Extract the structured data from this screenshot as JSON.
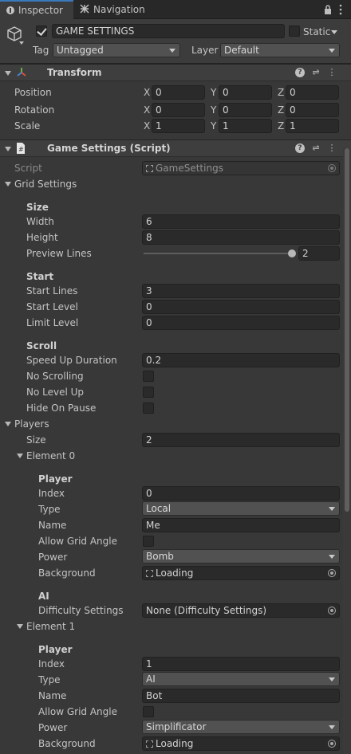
{
  "tabs": [
    {
      "label": "Inspector",
      "icon": "info-icon"
    },
    {
      "label": "Navigation",
      "icon": "navigation-icon"
    }
  ],
  "object": {
    "active": true,
    "name": "GAME SETTINGS",
    "static_label": "Static",
    "static": false,
    "tag_label": "Tag",
    "tag_value": "Untagged",
    "layer_label": "Layer",
    "layer_value": "Default"
  },
  "transform": {
    "title": "Transform",
    "rows": [
      {
        "label": "Position",
        "x": "0",
        "y": "0",
        "z": "0"
      },
      {
        "label": "Rotation",
        "x": "0",
        "y": "0",
        "z": "0"
      },
      {
        "label": "Scale",
        "x": "1",
        "y": "1",
        "z": "1"
      }
    ],
    "axis_x": "X",
    "axis_y": "Y",
    "axis_z": "Z"
  },
  "script_component": {
    "title": "Game Settings (Script)",
    "script_label": "Script",
    "script_value": "GameSettings"
  },
  "grid_settings": {
    "label": "Grid Settings",
    "size_header": "Size",
    "width_label": "Width",
    "width": "6",
    "height_label": "Height",
    "height": "8",
    "preview_label": "Preview Lines",
    "preview_value": "2",
    "preview_fraction": 1.0,
    "start_header": "Start",
    "start_lines_label": "Start Lines",
    "start_lines": "3",
    "start_level_label": "Start Level",
    "start_level": "0",
    "limit_level_label": "Limit Level",
    "limit_level": "0",
    "scroll_header": "Scroll",
    "speed_label": "Speed Up Duration",
    "speed": "0.2",
    "no_scrolling_label": "No Scrolling",
    "no_scrolling": false,
    "no_level_up_label": "No Level Up",
    "no_level_up": false,
    "hide_pause_label": "Hide On Pause",
    "hide_pause": false
  },
  "players": {
    "label": "Players",
    "size_label": "Size",
    "size": "2",
    "elements": [
      {
        "label": "Element 0",
        "player_header": "Player",
        "index_label": "Index",
        "index": "0",
        "type_label": "Type",
        "type": "Local",
        "name_label": "Name",
        "name": "Me",
        "grid_angle_label": "Allow Grid Angle",
        "grid_angle": false,
        "power_label": "Power",
        "power": "Bomb",
        "background_label": "Background",
        "background": "Loading",
        "ai_header": "AI",
        "difficulty_label": "Difficulty Settings",
        "difficulty": "None (Difficulty Settings)"
      },
      {
        "label": "Element 1",
        "player_header": "Player",
        "index_label": "Index",
        "index": "1",
        "type_label": "Type",
        "type": "AI",
        "name_label": "Name",
        "name": "Bot",
        "grid_angle_label": "Allow Grid Angle",
        "grid_angle": false,
        "power_label": "Power",
        "power": "Simplificator",
        "background_label": "Background",
        "background": "Loading"
      }
    ]
  },
  "colors": {
    "panel": "#383838",
    "tab_bar": "#282828",
    "active_tab_accent": "#3a79bb",
    "field_bg": "#2a2a2a",
    "dropdown_bg": "#515151"
  }
}
